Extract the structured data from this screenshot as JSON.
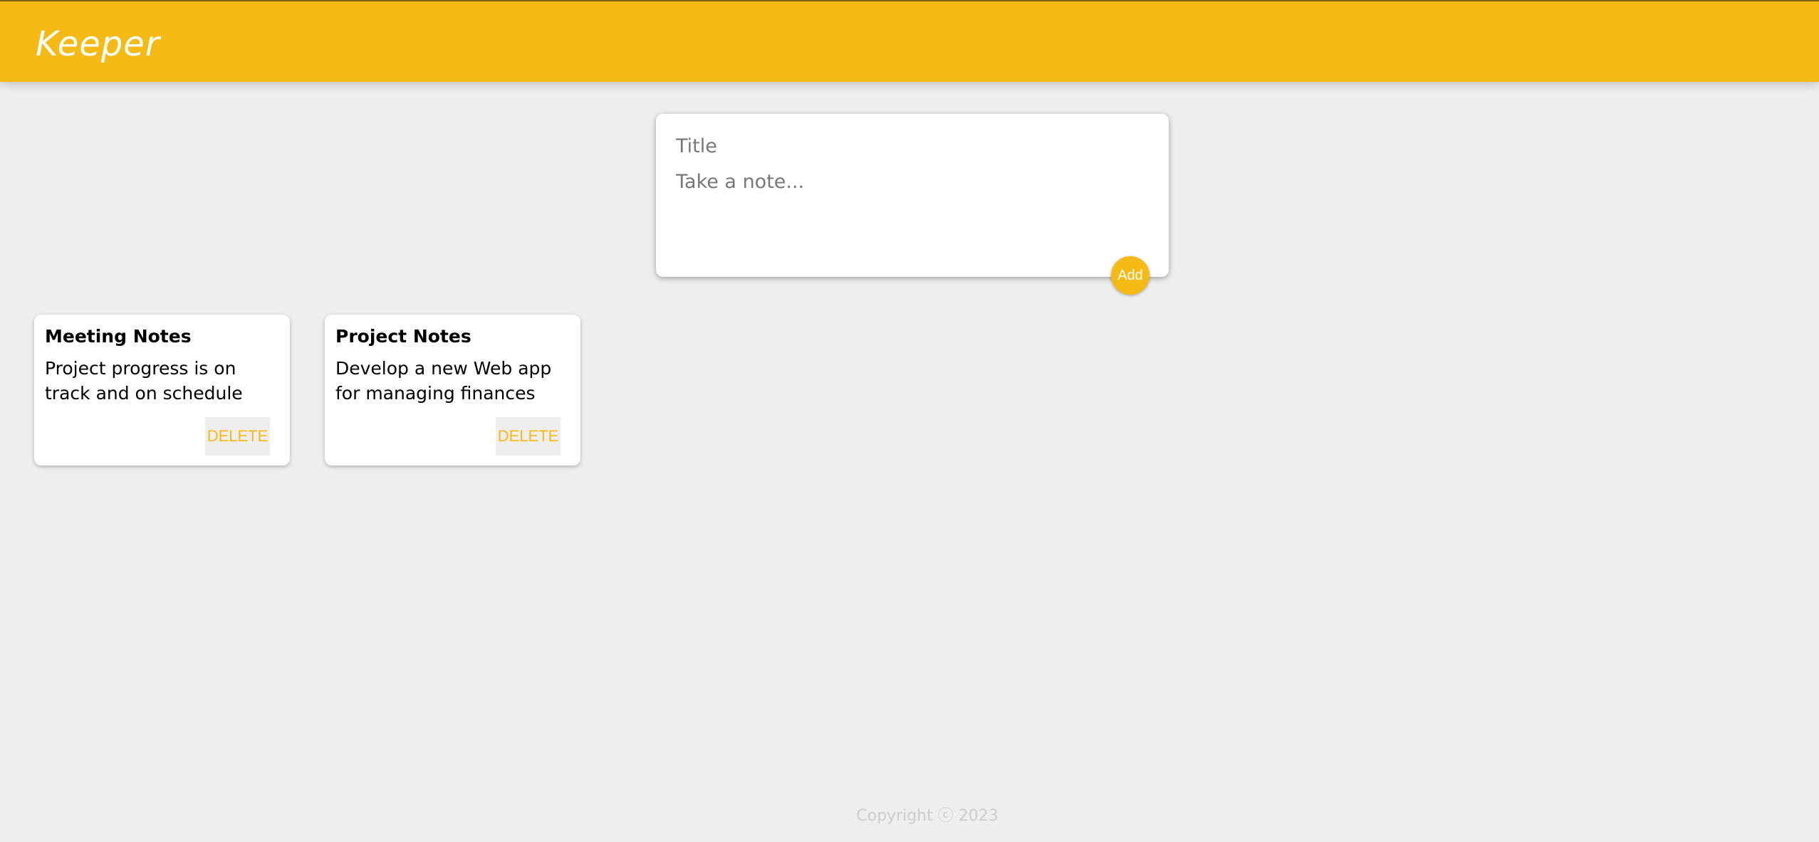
{
  "header": {
    "app_title": "Keeper"
  },
  "create_area": {
    "title_placeholder": "Title",
    "title_value": "",
    "content_placeholder": "Take a note...",
    "content_value": "",
    "add_label": "Add"
  },
  "notes": [
    {
      "title": "Meeting Notes",
      "content": "Project progress is on track and on schedule",
      "delete_label": "DELETE"
    },
    {
      "title": "Project Notes",
      "content": "Develop a new Web app for managing finances",
      "delete_label": "DELETE"
    }
  ],
  "footer": {
    "copyright": "Copyright ⓒ 2023"
  },
  "colors": {
    "accent": "#f5ba13",
    "background": "#eeeeee",
    "card": "#ffffff",
    "footer_text": "#cccccc"
  }
}
